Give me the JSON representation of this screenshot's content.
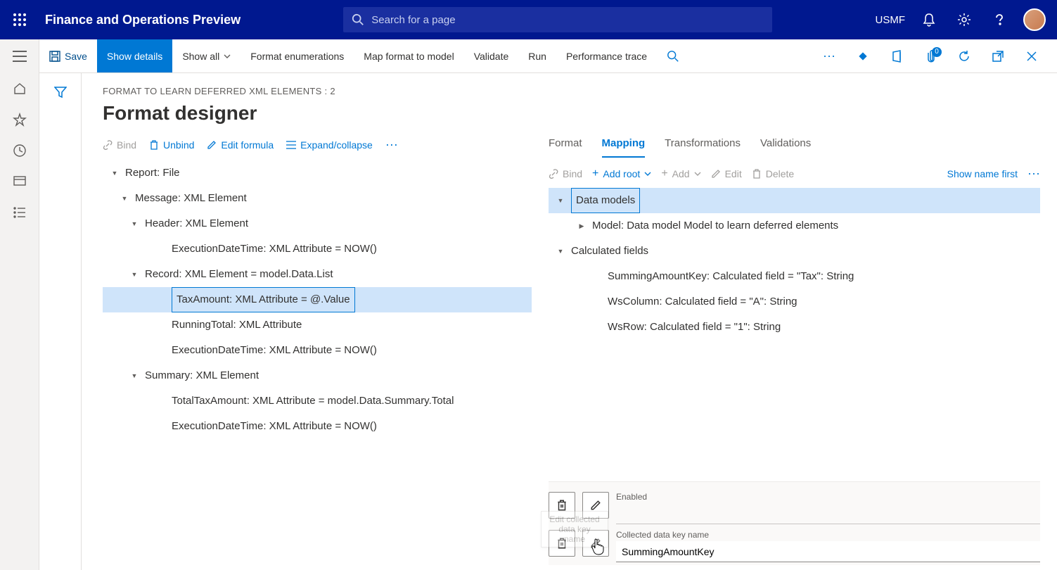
{
  "topbar": {
    "app_title": "Finance and Operations Preview",
    "search_placeholder": "Search for a page",
    "company": "USMF"
  },
  "cmdbar": {
    "save": "Save",
    "show_details": "Show details",
    "show_all": "Show all",
    "format_enum": "Format enumerations",
    "map_format": "Map format to model",
    "validate": "Validate",
    "run": "Run",
    "perf_trace": "Performance trace",
    "attach_count": "0"
  },
  "breadcrumb": "FORMAT TO LEARN DEFERRED XML ELEMENTS : 2",
  "page_title": "Format designer",
  "tree_actions": {
    "bind": "Bind",
    "unbind": "Unbind",
    "edit_formula": "Edit formula",
    "expand": "Expand/collapse"
  },
  "format_tree": [
    {
      "level": 0,
      "caret": "▾",
      "text": "Report: File"
    },
    {
      "level": 1,
      "caret": "▾",
      "text": "Message: XML Element"
    },
    {
      "level": 2,
      "caret": "▾",
      "text": "Header: XML Element"
    },
    {
      "level": 3,
      "caret": "",
      "text": "ExecutionDateTime: XML Attribute = NOW()"
    },
    {
      "level": 2,
      "caret": "▾",
      "text": "Record: XML Element = model.Data.List"
    },
    {
      "level": 3,
      "caret": "",
      "text": "TaxAmount: XML Attribute = @.Value",
      "selected": true
    },
    {
      "level": 3,
      "caret": "",
      "text": "RunningTotal: XML Attribute"
    },
    {
      "level": 3,
      "caret": "",
      "text": "ExecutionDateTime: XML Attribute = NOW()"
    },
    {
      "level": 2,
      "caret": "▾",
      "text": "Summary: XML Element"
    },
    {
      "level": 3,
      "caret": "",
      "text": "TotalTaxAmount: XML Attribute = model.Data.Summary.Total"
    },
    {
      "level": 3,
      "caret": "",
      "text": "ExecutionDateTime: XML Attribute = NOW()"
    }
  ],
  "tabs": {
    "format": "Format",
    "mapping": "Mapping",
    "transformations": "Transformations",
    "validations": "Validations"
  },
  "ds_actions": {
    "bind": "Bind",
    "add_root": "Add root",
    "add": "Add",
    "edit": "Edit",
    "delete": "Delete",
    "show_name": "Show name first"
  },
  "ds_tree": [
    {
      "level": 0,
      "caret": "▾",
      "text": "Data models",
      "selected": true
    },
    {
      "level": 1,
      "caret": "▸",
      "text": "Model: Data model Model to learn deferred elements"
    },
    {
      "level": 0,
      "caret": "▾",
      "text": "Calculated fields"
    },
    {
      "level": 1,
      "caret": "",
      "text": "SummingAmountKey: Calculated field = \"Tax\": String"
    },
    {
      "level": 1,
      "caret": "",
      "text": "WsColumn: Calculated field = \"A\": String"
    },
    {
      "level": 1,
      "caret": "",
      "text": "WsRow: Calculated field = \"1\": String"
    }
  ],
  "props": {
    "enabled_label": "Enabled",
    "enabled_value": "",
    "key_label": "Collected data key name",
    "key_value": "SummingAmountKey",
    "tooltip": "Edit collected data key name"
  }
}
